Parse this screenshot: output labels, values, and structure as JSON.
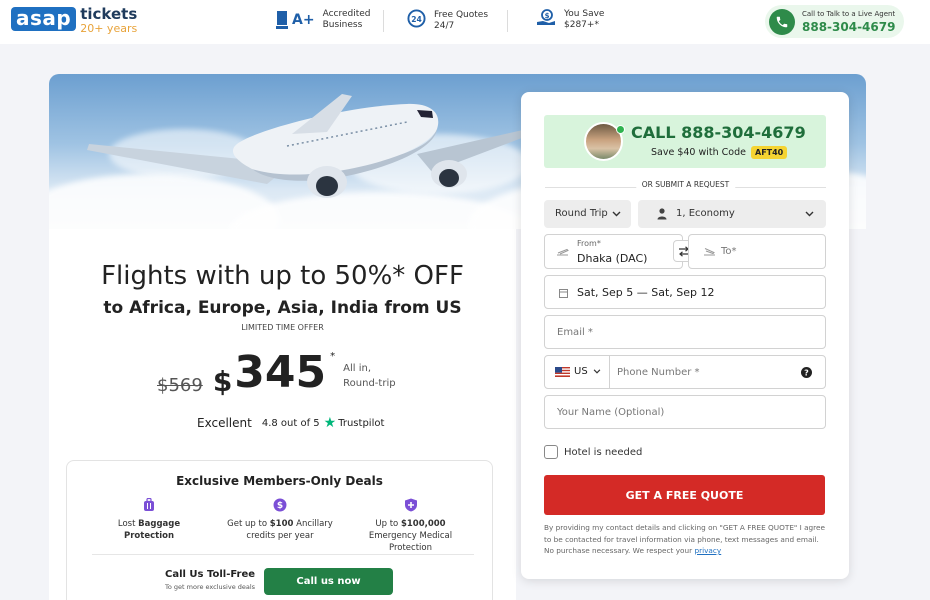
{
  "header": {
    "logo_main": "asap",
    "logo_tickets": "tickets",
    "logo_years": "20+ years",
    "features": [
      {
        "line1": "Accredited",
        "line2": "Business",
        "icon": "bbb-accredited-icon"
      },
      {
        "line1": "Free Quotes",
        "line2": "24/7",
        "icon": "clock-24-icon"
      },
      {
        "line1": "You Save",
        "line2": "$287+*",
        "icon": "money-hand-icon"
      }
    ],
    "bbb_rating": "A+",
    "agent_label": "Call to Talk to a Live Agent",
    "agent_phone": "888-304-4679"
  },
  "promo": {
    "title": "Flights with up to 50%* OFF",
    "subtitle": "to Africa, Europe, Asia, India from US",
    "limited": "LIMITED TIME OFFER",
    "old_price": "$569",
    "currency": "$",
    "new_price": "345",
    "asterisk": "*",
    "all_in_1": "All in,",
    "all_in_2": "Round-trip",
    "trust_rating": "Excellent",
    "trust_score": "4.8 out of 5",
    "trust_brand": "Trustpilot"
  },
  "members": {
    "title": "Exclusive Members-Only Deals",
    "items": [
      {
        "pre": "Lost ",
        "bold": "Baggage Protection",
        "post": "",
        "icon": "luggage-icon"
      },
      {
        "pre": "Get up to ",
        "bold": "$100",
        "post": " Ancillary credits per year",
        "icon": "dollar-coin-icon"
      },
      {
        "pre": "Up to ",
        "bold": "$100,000",
        "post": " Emergency Medical Protection",
        "icon": "shield-plus-icon"
      }
    ],
    "toll_title": "Call Us Toll-Free",
    "toll_sub": "To get more exclusive deals",
    "call_button": "Call us now"
  },
  "form": {
    "call_label": "CALL 888-304-4679",
    "save_text": "Save $40 with Code",
    "code": "AFT40",
    "or_text": "OR SUBMIT A REQUEST",
    "trip_type": "Round Trip",
    "passengers": "1, Economy",
    "from_label": "From*",
    "from_value": "Dhaka (DAC)",
    "to_placeholder": "To*",
    "dates": "Sat, Sep 5 — Sat, Sep 12",
    "email_placeholder": "Email *",
    "country": "US",
    "phone_placeholder": "Phone Number *",
    "name_placeholder": "Your Name (Optional)",
    "hotel_label": "Hotel is needed",
    "submit": "GET A FREE QUOTE",
    "disclaimer": "By providing my contact details and clicking on \"GET A FREE QUOTE\" I agree to be contacted for travel information via phone, text messages and email. No purchase necessary. We respect your ",
    "privacy": "privacy"
  },
  "colors": {
    "brand_blue": "#1f70c1",
    "green": "#238046",
    "red_cta": "#d42a26",
    "code_yellow": "#f5d432"
  }
}
